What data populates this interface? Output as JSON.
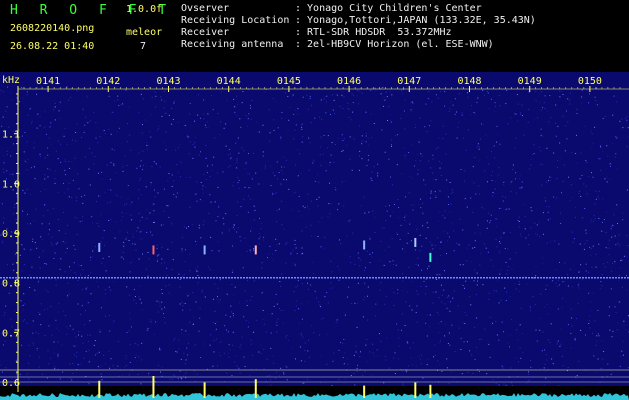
{
  "header": {
    "logo": "H R O F F T",
    "version": "1.0.0f",
    "filename": "2608220140.png",
    "datetime": "26.08.22 01:40",
    "meteor_label": "meleor",
    "meteor_count": "7",
    "info": [
      {
        "label": "Ovserver",
        "value": ": Yonago City Children's Center"
      },
      {
        "label": "Receiving Location",
        "value": ": Yonago,Tottori,JAPAN (133.32E, 35.43N)"
      },
      {
        "label": "Receiver",
        "value": ": RTL-SDR HDSDR  53.372MHz"
      },
      {
        "label": "Receiving antenna",
        "value": ": 2el-HB9CV Horizon (el. ESE-WNW)"
      }
    ]
  },
  "colors": {
    "background": "#0a0a6e",
    "noise_light": "#4a5cff",
    "noise_mid": "#2a2ab8",
    "carrier": "#6f8cff",
    "axis_text": "#ffff66",
    "spectrum": "#38e8ff"
  },
  "chart_data": {
    "type": "heatmap",
    "ylabel": "kHz",
    "ylim": [
      0.58,
      1.2
    ],
    "yticks": [
      "1.1",
      "1.0",
      "0.9",
      "0.8",
      "0.7",
      "0.6"
    ],
    "ytick_values": [
      1.1,
      1.0,
      0.9,
      0.8,
      0.7,
      0.6
    ],
    "xlim": [
      140.5,
      150.5
    ],
    "xticks": [
      "0141",
      "0142",
      "0143",
      "0144",
      "0145",
      "0146",
      "0147",
      "0148",
      "0149",
      "0150"
    ],
    "xtick_values": [
      141,
      142,
      143,
      144,
      145,
      146,
      147,
      148,
      149,
      150
    ],
    "carrier_freq": 0.81,
    "meteor_pings": [
      {
        "t": 141.85,
        "f": 0.87,
        "color": "#8fb0ff",
        "peak": 0.7
      },
      {
        "t": 142.75,
        "f": 0.865,
        "color": "#ff6060",
        "peak": 1.0
      },
      {
        "t": 143.6,
        "f": 0.865,
        "color": "#8fb0ff",
        "peak": 0.6
      },
      {
        "t": 144.45,
        "f": 0.865,
        "color": "#ffb0b0",
        "peak": 0.8
      },
      {
        "t": 146.25,
        "f": 0.875,
        "color": "#8fb0ff",
        "peak": 0.4
      },
      {
        "t": 147.1,
        "f": 0.88,
        "color": "#b0c8ff",
        "peak": 0.6
      },
      {
        "t": 147.35,
        "f": 0.85,
        "color": "#40ffcc",
        "peak": 0.45
      }
    ]
  }
}
